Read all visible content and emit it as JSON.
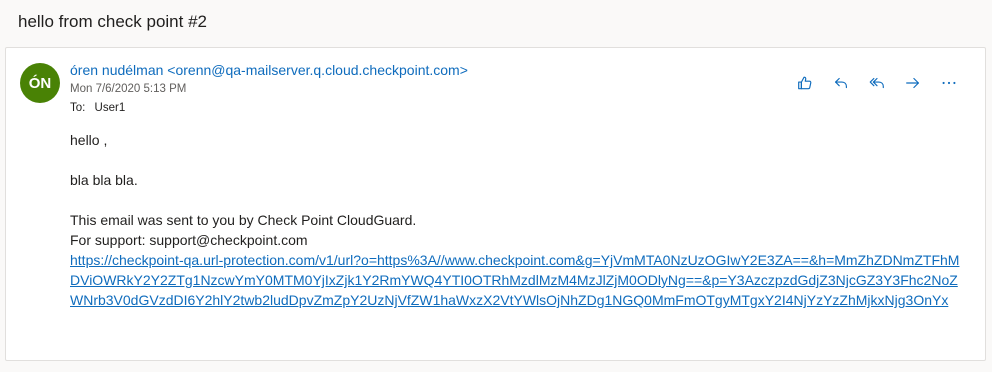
{
  "subject": "hello from check point #2",
  "message": {
    "avatar_initials": "ÓN",
    "sender": "óren nudélman <orenn@qa-mailserver.q.cloud.checkpoint.com>",
    "date": "Mon 7/6/2020 5:13 PM",
    "to_label": "To:",
    "to_value": "User1",
    "body": {
      "greeting": "hello ,",
      "text": "bla bla bla.",
      "footer1": "This email was sent to you by Check Point CloudGuard.",
      "footer2": "For support: support@checkpoint.com",
      "link": "https://checkpoint-qa.url-protection.com/v1/url?o=https%3A//www.checkpoint.com&g=YjVmMTA0NzUzOGIwY2E3ZA==&h=MmZhZDNmZTFhMDViOWRkY2Y2ZTg1NzcwYmY0MTM0YjIxZjk1Y2RmYWQ4YTI0OTRhMzdlMzM4MzJlZjM0ODlyNg==&p=Y3AzczpzdGdjZ3NjcGZ3Y3Fhc2NoZWNrb3V0dGVzdDI6Y2hlY2twb2ludDpvZmZpY2UzNjVfZW1haWxzX2VtYWlsOjNhZDg1NGQ0MmFmOTgyMTgxY2I4NjYzYzZhMjkxNjg3OnYx"
    }
  },
  "actions": [
    {
      "name": "like-icon",
      "color": "#0f6cbd"
    },
    {
      "name": "reply-icon",
      "color": "#0f6cbd"
    },
    {
      "name": "reply-all-icon",
      "color": "#0f6cbd"
    },
    {
      "name": "forward-icon",
      "color": "#0f6cbd"
    },
    {
      "name": "more-icon",
      "color": "#0f6cbd"
    }
  ]
}
